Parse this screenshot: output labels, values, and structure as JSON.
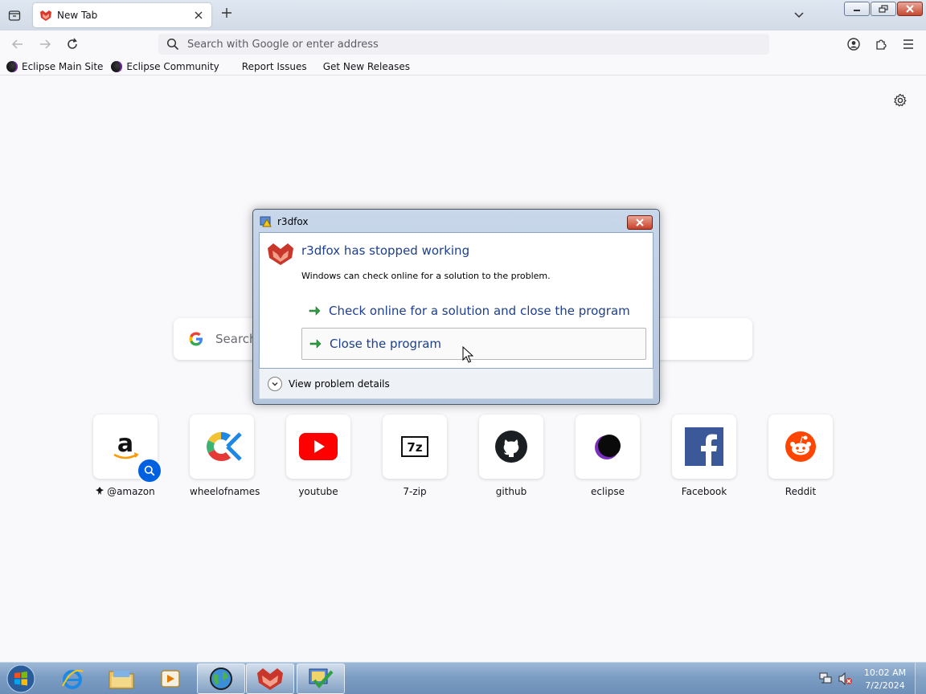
{
  "browser": {
    "tab_title": "New Tab",
    "address_placeholder": "Search with Google or enter address",
    "bookmarks": [
      {
        "label": "Eclipse Main Site"
      },
      {
        "label": "Eclipse Community"
      },
      {
        "label": "Report Issues"
      },
      {
        "label": "Get New Releases"
      }
    ]
  },
  "newtab": {
    "search_placeholder": "Search",
    "tiles": [
      {
        "label": "@amazon"
      },
      {
        "label": "wheelofnames"
      },
      {
        "label": "youtube"
      },
      {
        "label": "7-zip"
      },
      {
        "label": "github"
      },
      {
        "label": "eclipse"
      },
      {
        "label": "Facebook"
      },
      {
        "label": "Reddit"
      }
    ]
  },
  "dialog": {
    "title": "r3dfox",
    "heading": "r3dfox has stopped working",
    "description": "Windows can check online for a solution to the problem.",
    "option_check": "Check online for a solution and close the program",
    "option_close": "Close the program",
    "details": "View problem details"
  },
  "taskbar": {
    "time": "10:02 AM",
    "date": "7/2/2024"
  },
  "colors": {
    "accent_blue": "#0061e0",
    "dialog_link": "#1e3f8c"
  }
}
